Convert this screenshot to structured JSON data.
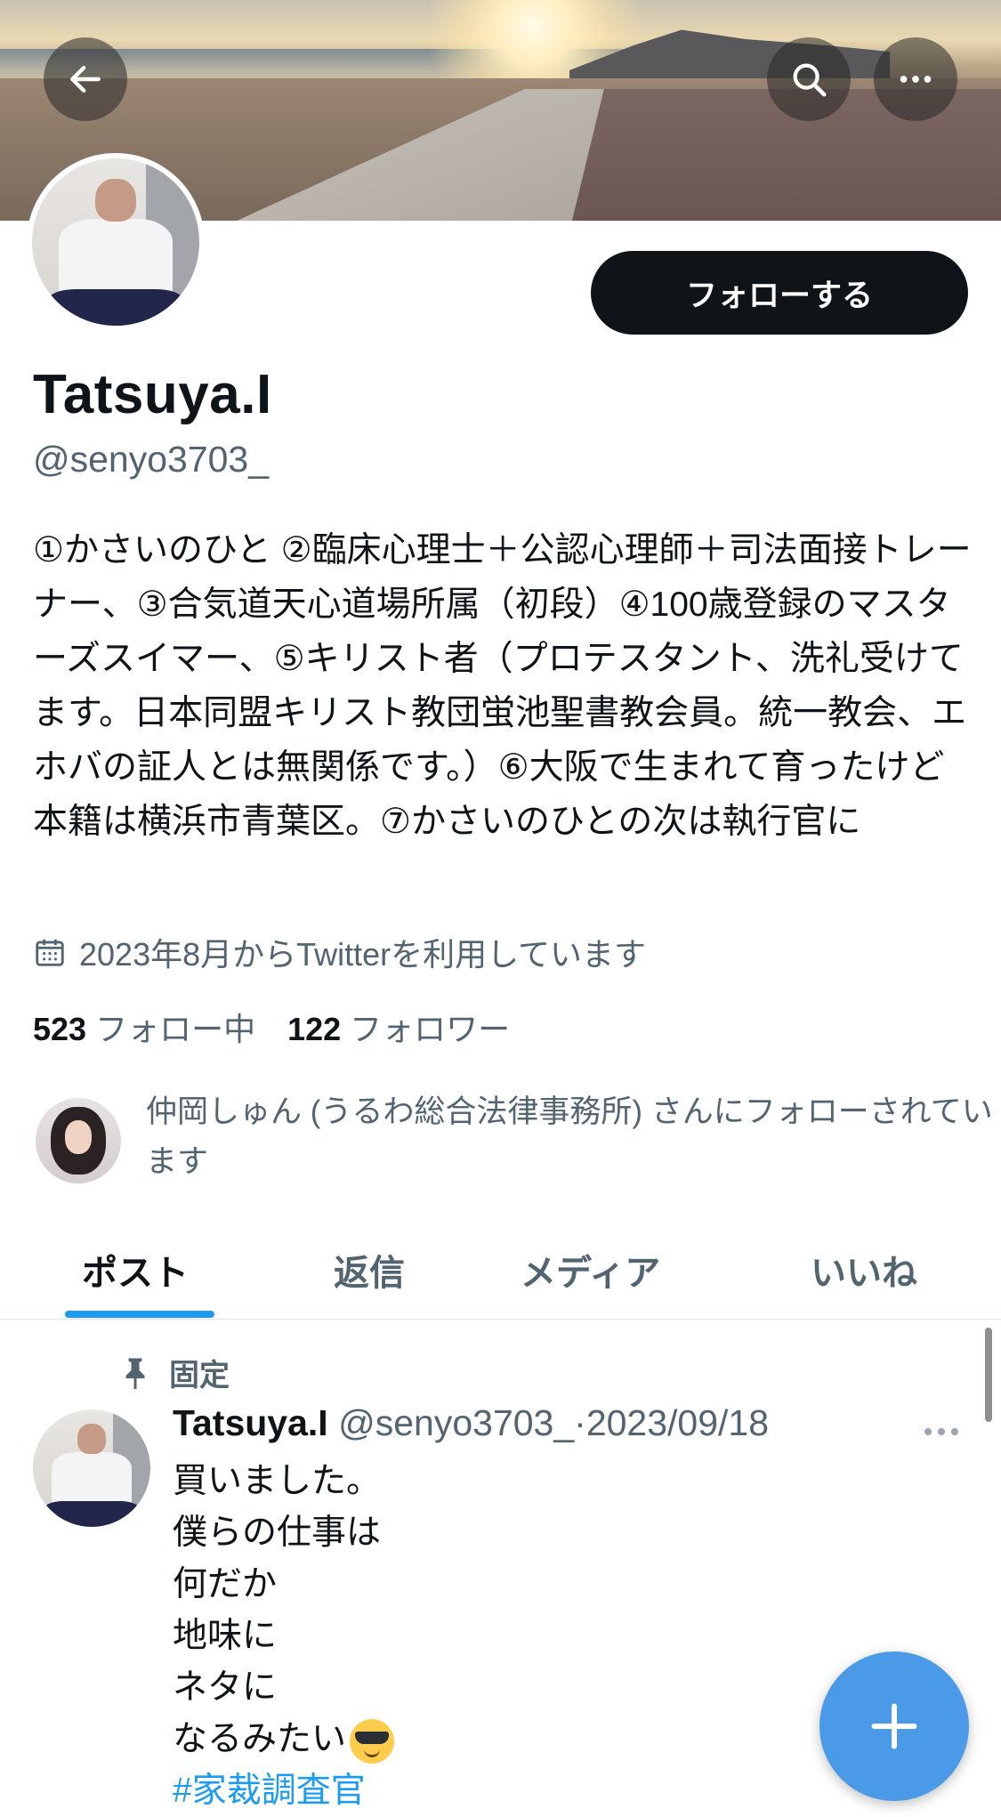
{
  "profile": {
    "name": "Tatsuya.I",
    "handle": "@senyo3703_",
    "follow_button": "フォローする",
    "bio": "①かさいのひと ②臨床心理士＋公認心理師＋司法面接トレーナー、③合気道天心道場所属（初段）④100歳登録のマスターズスイマー、⑤キリスト者（プロテスタント、洗礼受けてます。日本同盟キリスト教団蛍池聖書教会員。統一教会、エホバの証人とは無関係です。）⑥大阪で生まれて育ったけど本籍は横浜市青葉区。⑦かさいのひとの次は執行官に",
    "joined": "2023年8月からTwitterを利用しています",
    "following_count": "523",
    "following_label": "フォロー中",
    "followers_count": "122",
    "followers_label": "フォロワー",
    "followed_by": "仲岡しゅん (うるわ総合法律事務所) さんにフォローされています"
  },
  "tabs": [
    {
      "label": "ポスト",
      "active": true
    },
    {
      "label": "返信",
      "active": false
    },
    {
      "label": "メディア",
      "active": false
    },
    {
      "label": "いいね",
      "active": false
    }
  ],
  "pinned_post": {
    "pinned_label": "固定",
    "author": "Tatsuya.I",
    "handle": "@senyo3703_",
    "separator": "·",
    "date": "2023/09/18",
    "lines": [
      "買いました。",
      "僕らの仕事は",
      "何だか",
      "地味に",
      "ネタに",
      "なるみたい"
    ],
    "hashtag": "#家裁調査官"
  },
  "icons": {
    "back": "back-arrow-icon",
    "search": "search-icon",
    "more": "more-icon",
    "calendar": "calendar-icon",
    "pin": "pin-icon",
    "compose": "plus-icon",
    "emoji": "sunglasses-emoji-icon"
  },
  "colors": {
    "accent": "#1d9bf0",
    "text": "#0f1419",
    "secondary_text": "#536471",
    "fab": "#4a9ae8"
  }
}
